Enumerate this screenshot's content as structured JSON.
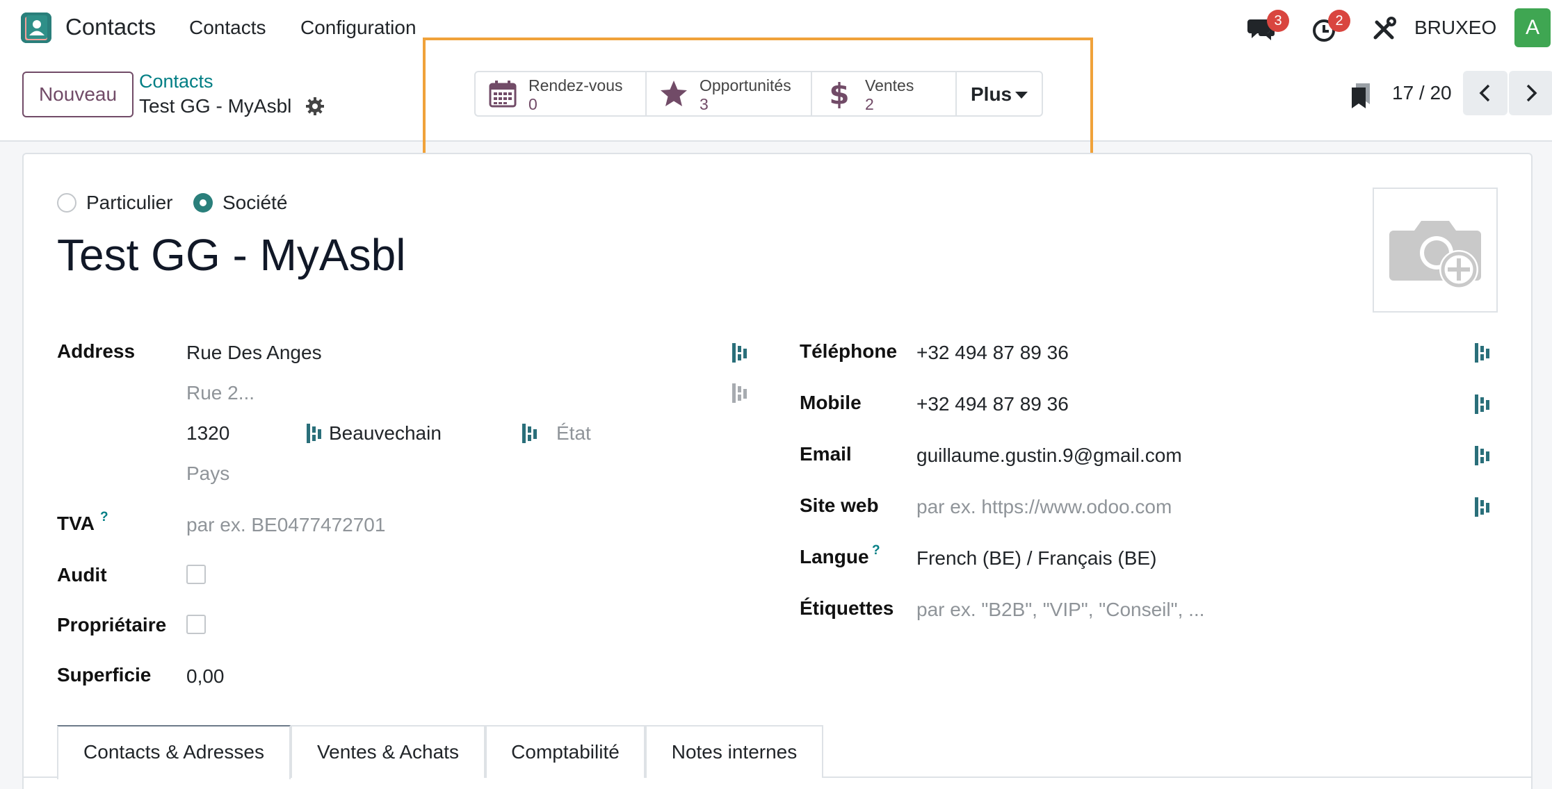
{
  "navbar": {
    "app_name": "Contacts",
    "menu": [
      "Contacts",
      "Configuration"
    ],
    "messages_count": "3",
    "activities_count": "2",
    "company": "BRUXEO",
    "avatar_letter": "A"
  },
  "control": {
    "new_button": "Nouveau",
    "breadcrumb_parent": "Contacts",
    "breadcrumb_current": "Test GG - MyAsbl",
    "smart_buttons": [
      {
        "label": "Rendez-vous",
        "value": "0",
        "icon": "calendar-icon"
      },
      {
        "label": "Opportunités",
        "value": "3",
        "icon": "star-icon"
      },
      {
        "label": "Ventes",
        "value": "2",
        "icon": "dollar-icon"
      }
    ],
    "more_button": "Plus",
    "pager": "17 / 20"
  },
  "form": {
    "type_options": [
      "Particulier",
      "Société"
    ],
    "selected_type": "Société",
    "name": "Test GG - MyAsbl",
    "left": {
      "address_label": "Address",
      "street": "Rue Des Anges",
      "street2_placeholder": "Rue 2...",
      "zip": "1320",
      "city": "Beauvechain",
      "state_placeholder": "État",
      "country_placeholder": "Pays",
      "vat_label": "TVA",
      "vat_placeholder": "par ex. BE0477472701",
      "audit_label": "Audit",
      "owner_label": "Propriétaire",
      "area_label": "Superficie",
      "area_value": "0,00"
    },
    "right": {
      "phone_label": "Téléphone",
      "phone": "+32 494 87 89 36",
      "mobile_label": "Mobile",
      "mobile": "+32 494 87 89 36",
      "email_label": "Email",
      "email": "guillaume.gustin.9@gmail.com",
      "website_label": "Site web",
      "website_placeholder": "par ex. https://www.odoo.com",
      "lang_label": "Langue",
      "lang": "French (BE) / Français (BE)",
      "tags_label": "Étiquettes",
      "tags_placeholder": "par ex. \"B2B\", \"VIP\", \"Conseil\", ..."
    },
    "help_mark": "?"
  },
  "tabs": [
    "Contacts & Adresses",
    "Ventes & Achats",
    "Comptabilité",
    "Notes internes"
  ],
  "colors": {
    "brand": "#714b67",
    "accent": "#017e84",
    "highlight": "#f0a23a",
    "badge": "#d9453f"
  }
}
